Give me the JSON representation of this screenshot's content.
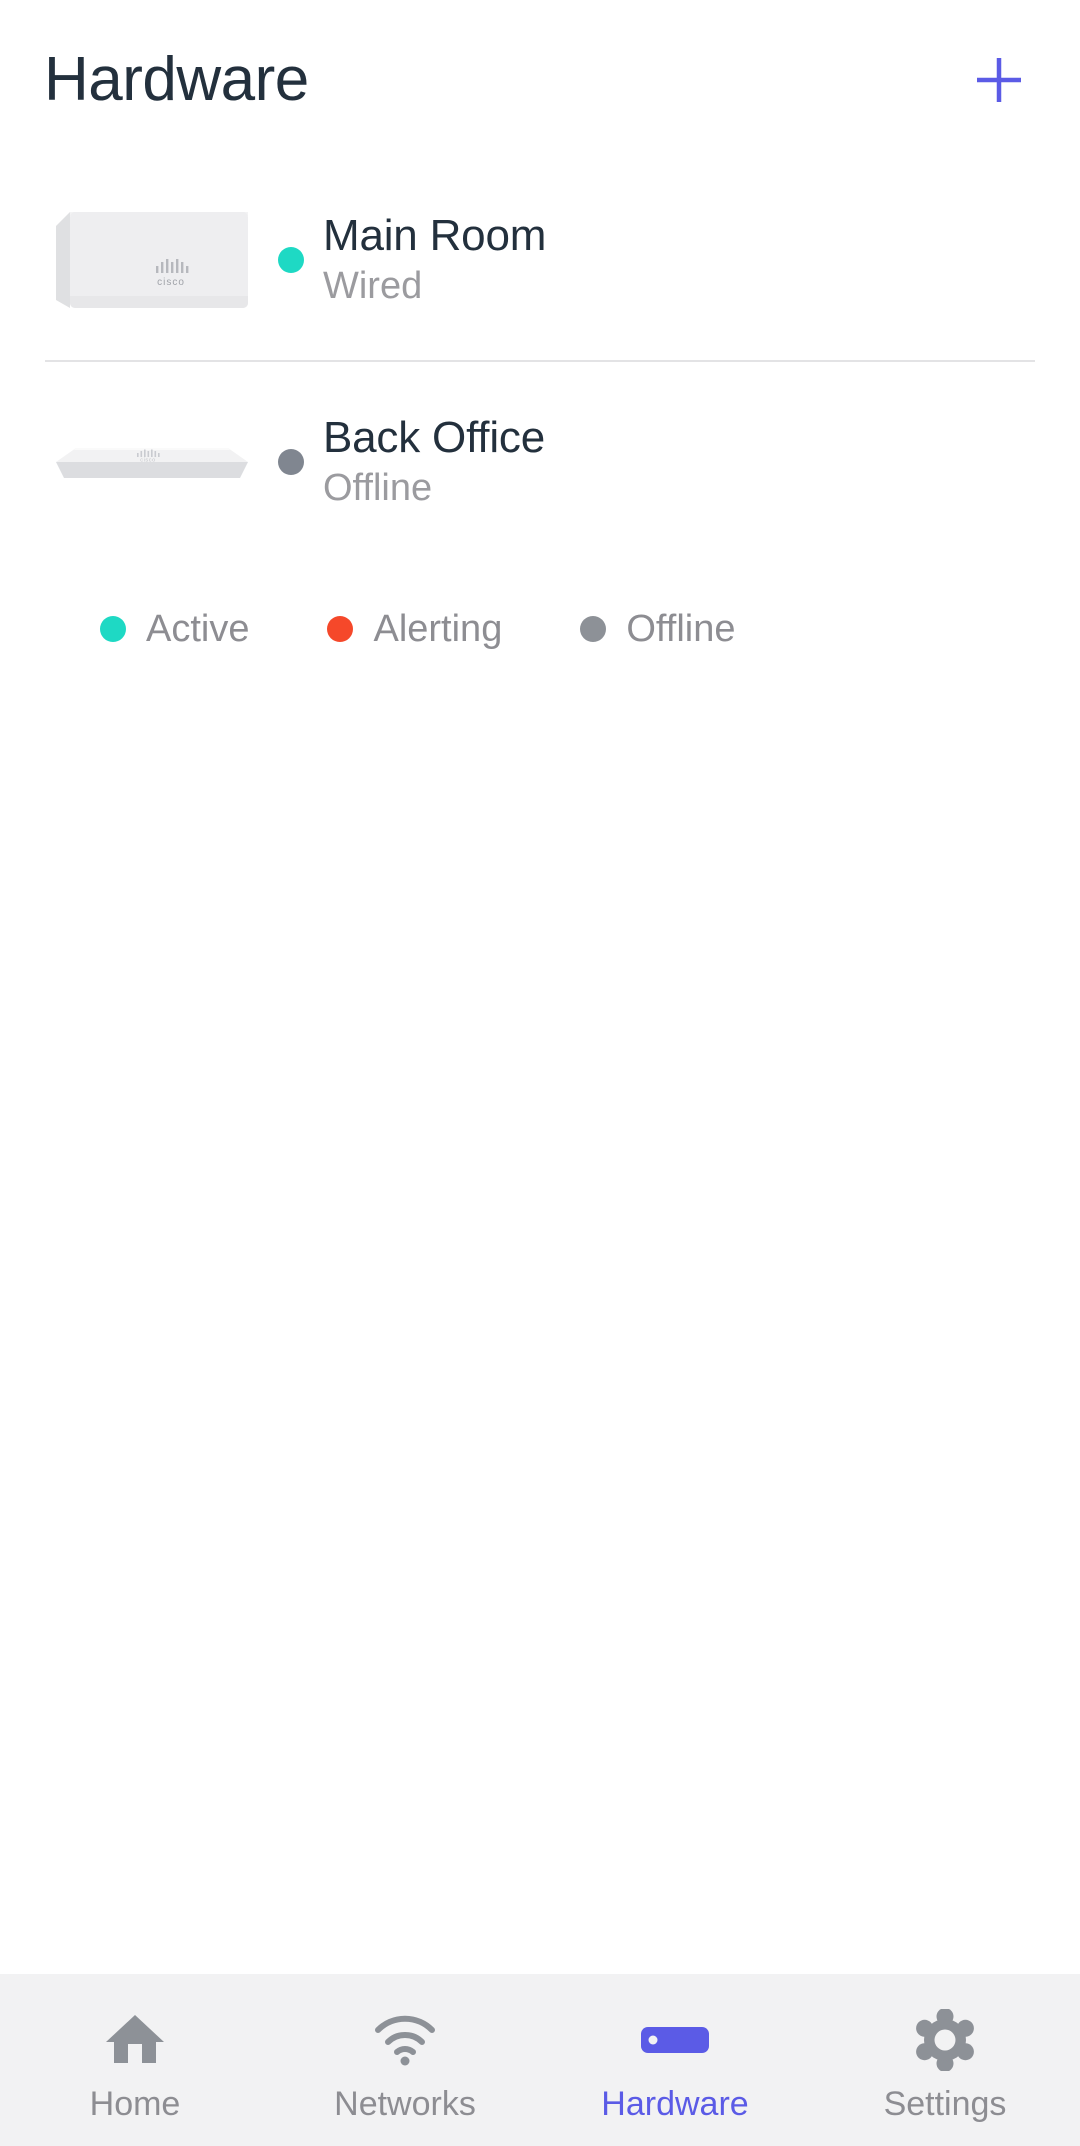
{
  "header": {
    "title": "Hardware",
    "add_icon": "plus-icon",
    "accent_color": "#5b5be6"
  },
  "devices": [
    {
      "name": "Main Room",
      "status": "Wired",
      "status_color": "#1ed9c4",
      "thumb_icon": "cisco-access-point-image",
      "brand_text": "cisco"
    },
    {
      "name": "Back Office",
      "status": "Offline",
      "status_color": "#808690",
      "thumb_icon": "cisco-switch-image",
      "brand_text": "cisco"
    }
  ],
  "legend": [
    {
      "label": "Active",
      "color": "#1ed9c4",
      "icon": "status-dot-active"
    },
    {
      "label": "Alerting",
      "color": "#f5482a",
      "icon": "status-dot-alerting"
    },
    {
      "label": "Offline",
      "color": "#8d9197",
      "icon": "status-dot-offline"
    }
  ],
  "bottom_nav": {
    "active_color": "#5b5be6",
    "inactive_color": "#8d8d92",
    "items": [
      {
        "label": "Home",
        "icon": "home-icon",
        "active": false
      },
      {
        "label": "Networks",
        "icon": "wifi-icon",
        "active": false
      },
      {
        "label": "Hardware",
        "icon": "hardware-icon",
        "active": true
      },
      {
        "label": "Settings",
        "icon": "gear-icon",
        "active": false
      }
    ]
  }
}
